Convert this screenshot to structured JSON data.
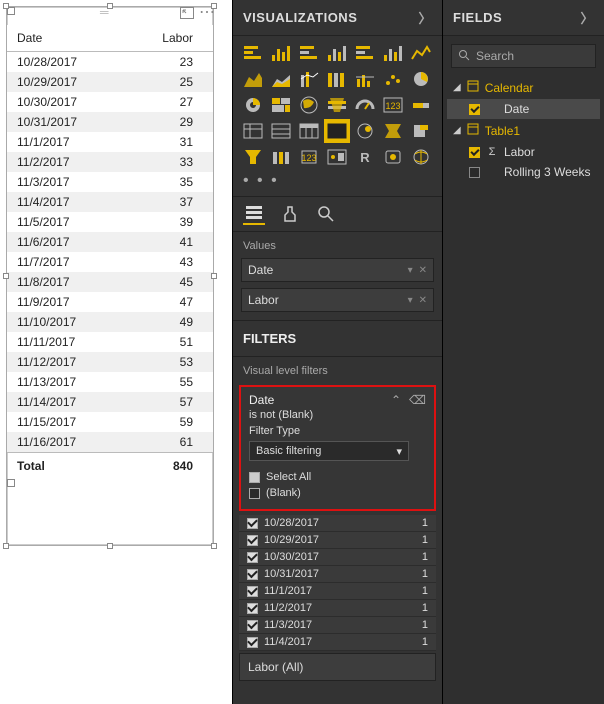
{
  "panes": {
    "visualizations": "VISUALIZATIONS",
    "fields": "FIELDS",
    "filters": "FILTERS"
  },
  "search": {
    "placeholder": "Search"
  },
  "table": {
    "headers": {
      "date": "Date",
      "labor": "Labor"
    },
    "rows": [
      {
        "date": "10/28/2017",
        "labor": "23"
      },
      {
        "date": "10/29/2017",
        "labor": "25"
      },
      {
        "date": "10/30/2017",
        "labor": "27"
      },
      {
        "date": "10/31/2017",
        "labor": "29"
      },
      {
        "date": "11/1/2017",
        "labor": "31"
      },
      {
        "date": "11/2/2017",
        "labor": "33"
      },
      {
        "date": "11/3/2017",
        "labor": "35"
      },
      {
        "date": "11/4/2017",
        "labor": "37"
      },
      {
        "date": "11/5/2017",
        "labor": "39"
      },
      {
        "date": "11/6/2017",
        "labor": "41"
      },
      {
        "date": "11/7/2017",
        "labor": "43"
      },
      {
        "date": "11/8/2017",
        "labor": "45"
      },
      {
        "date": "11/9/2017",
        "labor": "47"
      },
      {
        "date": "11/10/2017",
        "labor": "49"
      },
      {
        "date": "11/11/2017",
        "labor": "51"
      },
      {
        "date": "11/12/2017",
        "labor": "53"
      },
      {
        "date": "11/13/2017",
        "labor": "55"
      },
      {
        "date": "11/14/2017",
        "labor": "57"
      },
      {
        "date": "11/15/2017",
        "labor": "59"
      },
      {
        "date": "11/16/2017",
        "labor": "61"
      }
    ],
    "total_label": "Total",
    "total_value": "840"
  },
  "wells": {
    "values_label": "Values",
    "items": [
      {
        "name": "Date"
      },
      {
        "name": "Labor"
      }
    ]
  },
  "filters": {
    "visual_label": "Visual level filters",
    "card": {
      "field": "Date",
      "condition": "is not (Blank)",
      "type_label": "Filter Type",
      "type_value": "Basic filtering",
      "top_items": [
        {
          "label": "Select All",
          "checked": "square"
        },
        {
          "label": "(Blank)",
          "checked": "off"
        }
      ]
    },
    "list": [
      {
        "label": "10/28/2017",
        "count": "1"
      },
      {
        "label": "10/29/2017",
        "count": "1"
      },
      {
        "label": "10/30/2017",
        "count": "1"
      },
      {
        "label": "10/31/2017",
        "count": "1"
      },
      {
        "label": "11/1/2017",
        "count": "1"
      },
      {
        "label": "11/2/2017",
        "count": "1"
      },
      {
        "label": "11/3/2017",
        "count": "1"
      },
      {
        "label": "11/4/2017",
        "count": "1"
      }
    ],
    "labor_row": "Labor  (All)"
  },
  "fields_tree": {
    "groups": [
      {
        "name": "Calendar",
        "items": [
          {
            "label": "Date",
            "checked": true,
            "selected": true,
            "icon": ""
          }
        ]
      },
      {
        "name": "Table1",
        "items": [
          {
            "label": "Labor",
            "checked": true,
            "selected": false,
            "icon": "Σ"
          },
          {
            "label": "Rolling 3 Weeks",
            "checked": false,
            "selected": false,
            "icon": ""
          }
        ]
      }
    ]
  }
}
